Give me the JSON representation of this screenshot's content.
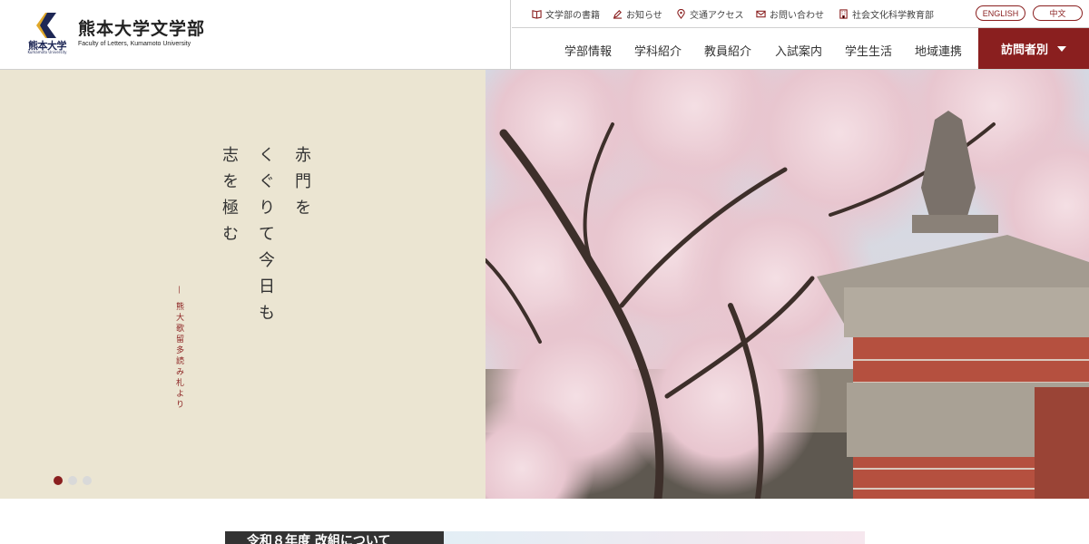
{
  "header": {
    "emblem_name": "熊本大学",
    "emblem_sub": "Kumamoto University",
    "title": "熊本大学文学部",
    "subtitle": "Faculty of Letters, Kumamoto University"
  },
  "utility_links": [
    {
      "label": "文学部の書籍",
      "icon": "book-icon"
    },
    {
      "label": "お知らせ",
      "icon": "pencil-icon"
    },
    {
      "label": "交通アクセス",
      "icon": "map-pin-icon"
    },
    {
      "label": "お問い合わせ",
      "icon": "mail-icon"
    },
    {
      "label": "社会文化科学教育部",
      "icon": "building-icon"
    }
  ],
  "lang": {
    "english": "ENGLISH",
    "chinese": "中文"
  },
  "global_nav": [
    "学部情報",
    "学科紹介",
    "教員紹介",
    "入試案内",
    "学生生活",
    "地域連携"
  ],
  "visitor_menu": "訪問者別",
  "hero": {
    "poem_col1": "赤門を",
    "poem_col2": "くぐりて今日も",
    "poem_col3": "志を極む",
    "quote": "— 熊大歌留多読み札より",
    "slides_total": 3,
    "slide_active": 1
  },
  "news": {
    "heading": "令和８年度 改組について"
  },
  "colors": {
    "accent": "#8a1f1f",
    "hero_bg": "#ebe5d2",
    "navy": "#1e2755",
    "gold": "#e0a82a"
  }
}
